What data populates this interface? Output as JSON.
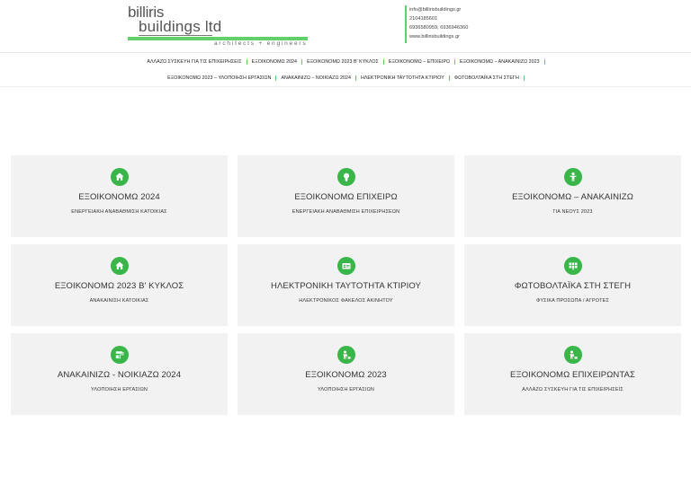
{
  "header": {
    "logo": {
      "line1": "billiris",
      "line2": "buildings ltd",
      "tagline": "architects + engineers",
      "accent_color": "#5fd06a"
    },
    "contact": {
      "email": "info@billirisbuildings.gr",
      "phone": "2104185601",
      "mobiles": "6936580959, 6936946360",
      "website": "www.billirisbuildings.gr"
    }
  },
  "nav": {
    "row1": [
      "ΑΛΛΑΖΩ ΣΥΣΚΕΥΗ ΓΙΑ ΤΙΣ ΕΠΙΧΕΙΡΗΣΕΙΣ",
      "ΕΞΟΙΚΟΝΟΜΩ 2024",
      "ΕΞΟΙΚΟΝΟΜΩ 2023 Β' ΚΥΚΛΟΣ",
      "ΕΞΟΙΚΟΝΟΜΩ – ΕΠΙΧΕΙΡΩ",
      "ΕΞΟΙΚΟΝΟΜΩ – ΑΝΑΚΑΙΝΙΖΩ 2023"
    ],
    "row2": [
      "ΕΞΟΙΚΟΝΟΜΩ 2023 – ΥΛΟΠΟΙΗΣΗ ΕΡΓΑΣΙΩΝ",
      "ΑΝΑΚΑΙΝΙΖΩ – ΝΟΙΚΙΑΖΩ 2024",
      "ΗΛΕΚΤΡΟΝΙΚΗ ΤΑΥΤΟΤΗΤΑ ΚΤΙΡΙΟΥ",
      "ΦΩΤΟΒΟΛΤΑΪΚΑ ΣΤΗ ΣΤΕΓΗ"
    ]
  },
  "cards": [
    {
      "title": "ΕΞΟΙΚΟΝΟΜΩ 2024",
      "subtitle": "ΕΝΕΡΓΕΙΑΚΗ ΑΝΑΒΑΘΜΙΣΗ ΚΑΤΟΙΚΙΑΣ",
      "icon": "home-icon"
    },
    {
      "title": "ΕΞΟΙΚΟΝΟΜΩ ΕΠΙΧΕΙΡΩ",
      "subtitle": "ΕΝΕΡΓΕΙΑΚΗ ΑΝΑΒΑΘΜΙΣΗ ΕΠΙΧΕΙΡΗΣΕΩΝ",
      "icon": "lightbulb-icon"
    },
    {
      "title": "ΕΞΟΙΚΟΝΟΜΩ – ΑΝΑΚΑΙΝΙΖΩ",
      "subtitle": "ΓΙΑ ΝΕΟΥΣ 2023",
      "icon": "person-icon"
    },
    {
      "title": "ΕΞΟΙΚΟΝΟΜΩ 2023 Β' ΚΥΚΛΟΣ",
      "subtitle": "ΑΝΑΚΑΙΝΙΣΗ ΚΑΤΟΙΚΙΑΣ",
      "icon": "home-icon"
    },
    {
      "title": "ΗΛΕΚΤΡΟΝΙΚΗ ΤΑΥΤΟΤΗΤΑ ΚΤΙΡΙΟΥ",
      "subtitle": "ΗΛΕΚΤΡΟΝΙΚΟΣ ΦΑΚΕΛΟΣ ΑΚΙΝΗΤΟΥ",
      "icon": "id-card-icon"
    },
    {
      "title": "ΦΩΤΟΒΟΛΤΑΪΚΑ ΣΤΗ ΣΤΕΓΗ",
      "subtitle": "ΦΥΣΙΚΑ ΠΡΟΣΩΠΑ / ΑΓΡΟΤΕΣ",
      "icon": "solar-panel-icon"
    },
    {
      "title": "ΑΝΑΚΑΙΝΙΖΩ - ΝΟΙΚΙΑΖΩ 2024",
      "subtitle": "ΥΛΟΠΟΙΗΣΗ ΕΡΓΑΣΙΩΝ",
      "icon": "paint-roller-icon"
    },
    {
      "title": "ΕΞΟΙΚΟΝΟΜΩ 2023",
      "subtitle": "ΥΛΟΠΟΙΗΣΗ ΕΡΓΑΣΙΩΝ",
      "icon": "worker-icon"
    },
    {
      "title": "ΕΞΟΙΚΟΝΟΜΩ ΕΠΙΧΕΙΡΩΝΤΑΣ",
      "subtitle": "ΑΛΛΑΖΩ ΣΥΣΚΕΥΗ ΓΙΑ ΤΙΣ ΕΠΙΧΕΙΡΗΣΕΙΣ",
      "icon": "worker-icon"
    }
  ],
  "colors": {
    "accent": "#39b54a",
    "card_bg": "#f2f2f2",
    "text": "#333333"
  }
}
